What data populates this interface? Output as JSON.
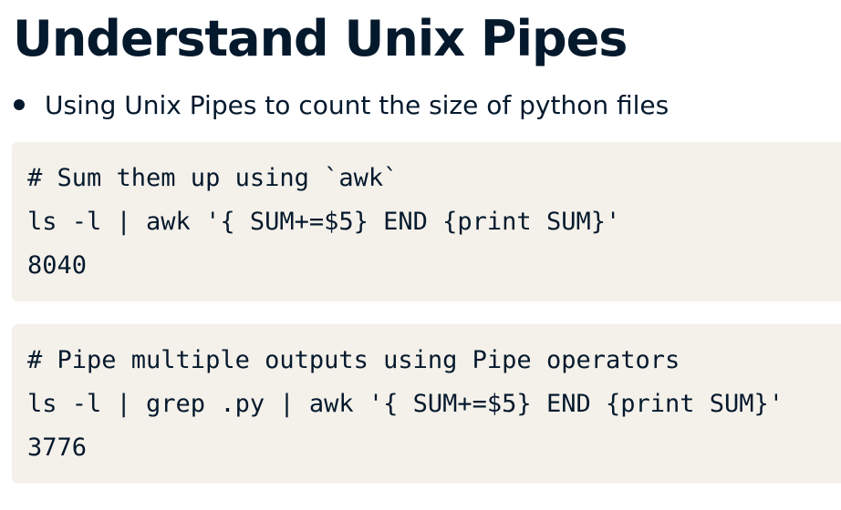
{
  "title": "Understand Unix Pipes",
  "bullets": [
    "Using Unix Pipes to count the size of python files"
  ],
  "code_blocks": [
    {
      "lines": [
        "# Sum them up using `awk`",
        "ls -l | awk '{ SUM+=$5} END {print SUM}'",
        "8040"
      ]
    },
    {
      "lines": [
        "# Pipe multiple outputs using Pipe operators",
        "ls -l | grep .py | awk '{ SUM+=$5} END {print SUM}'",
        "3776"
      ]
    }
  ],
  "colors": {
    "text": "#05192d",
    "code_background": "#f4f1ea",
    "page_background": "#ffffff"
  }
}
